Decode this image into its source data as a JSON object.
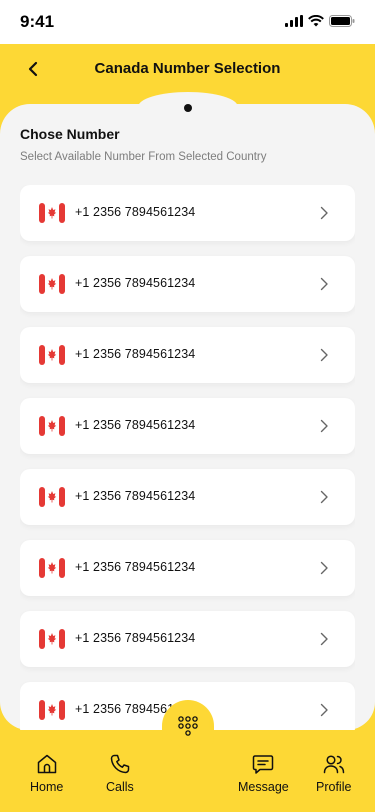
{
  "status_bar": {
    "time": "9:41"
  },
  "header": {
    "title": "Canada Number Selection"
  },
  "section": {
    "title": "Chose Number",
    "subtitle": "Select Available Number From Selected Country"
  },
  "numbers": [
    {
      "number": "+1 2356 7894561234"
    },
    {
      "number": "+1 2356 7894561234"
    },
    {
      "number": "+1 2356 7894561234"
    },
    {
      "number": "+1 2356 7894561234"
    },
    {
      "number": "+1 2356 7894561234"
    },
    {
      "number": "+1 2356 7894561234"
    },
    {
      "number": "+1 2356 7894561234"
    },
    {
      "number": "+1 2356 7894561234"
    }
  ],
  "nav": {
    "home": "Home",
    "calls": "Calls",
    "message": "Message",
    "profile": "Profile"
  },
  "colors": {
    "accent": "#FDD835",
    "panel": "#F4F4F4",
    "flag_red": "#E53935"
  }
}
